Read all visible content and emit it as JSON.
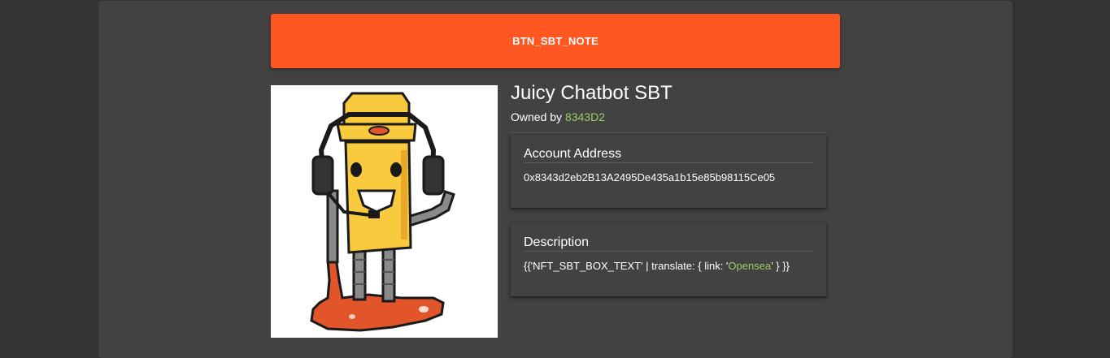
{
  "note_button": {
    "label": "BTN_SBT_NOTE"
  },
  "nft": {
    "title": "Juicy Chatbot SBT",
    "owned_prefix": "Owned by ",
    "owner": "8343D2"
  },
  "account_card": {
    "heading": "Account Address",
    "address": "0x8343d2eb2B13A2495De435a1b15e85b98115Ce05"
  },
  "description_card": {
    "heading": "Description",
    "text_before": "{{'NFT_SBT_BOX_TEXT' | translate: { link: '",
    "link_text": "Opensea",
    "text_after": "' } }}"
  },
  "colors": {
    "accent": "#ff5722",
    "link": "#9ccc65",
    "panel": "#424242",
    "page_bg": "#333333"
  }
}
